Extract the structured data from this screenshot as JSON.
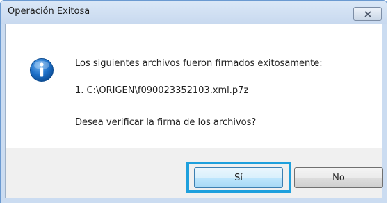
{
  "dialog": {
    "title": "Operación Exitosa",
    "close_icon": "close-icon",
    "icon": "information-icon",
    "message_line1": "Los siguientes archivos fueron firmados exitosamente:",
    "file_entry": "1. C:\\ORIGEN\\f090023352103.xml.p7z",
    "question": "Desea verificar la firma de los archivos?",
    "buttons": {
      "yes": "Sí",
      "no": "No"
    }
  },
  "colors": {
    "focus_ring": "#1ea0dd",
    "info_icon": "#1d6fc7",
    "frame": "#cbdcf1"
  }
}
